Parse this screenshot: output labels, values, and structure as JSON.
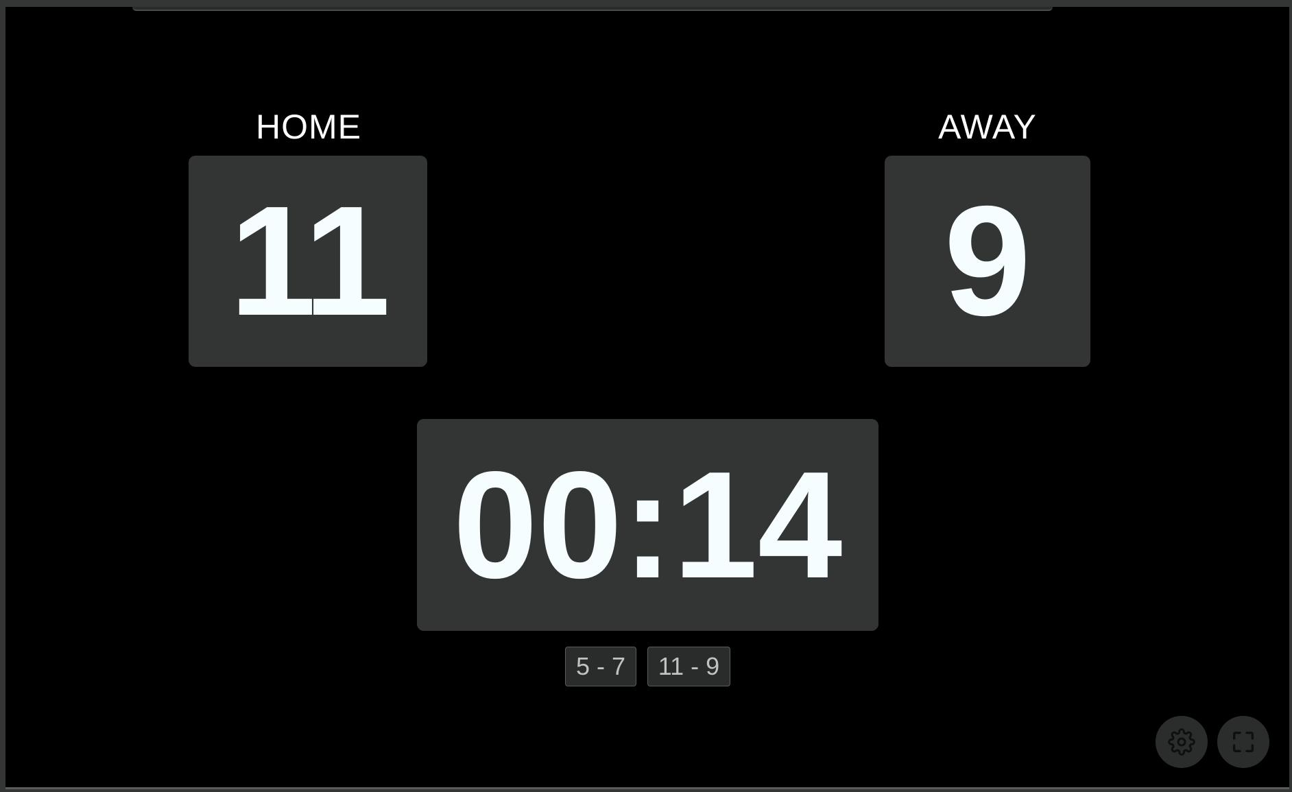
{
  "home": {
    "label": "HOME",
    "score": "11"
  },
  "away": {
    "label": "AWAY",
    "score": "9"
  },
  "clock": {
    "time": "00:14"
  },
  "history": [
    {
      "label": "5 - 7"
    },
    {
      "label": "11 - 9"
    }
  ],
  "controls": {
    "settings_icon": "gear-icon",
    "fullscreen_icon": "fullscreen-icon"
  },
  "colors": {
    "background": "#000000",
    "panel": "#333534",
    "digits": "#f5fdff",
    "label": "#ffffff"
  }
}
